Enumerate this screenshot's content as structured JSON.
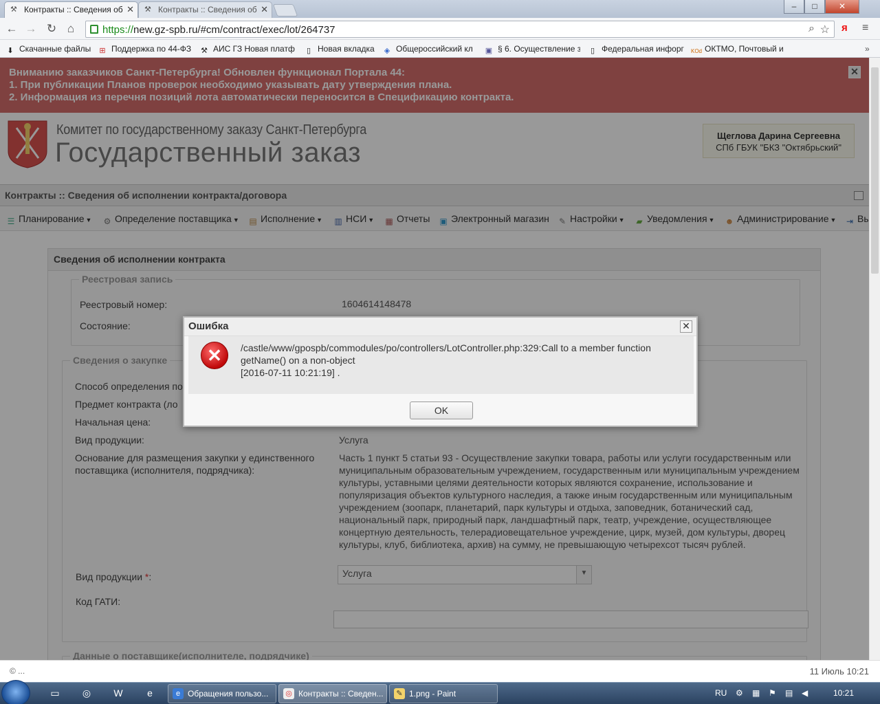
{
  "browser": {
    "tabs": [
      {
        "label": "Контракты :: Сведения об",
        "active": true
      },
      {
        "label": "Контракты :: Сведения об",
        "active": false
      }
    ],
    "url_scheme": "https://",
    "url_rest": "new.gz-spb.ru/#cm/contract/exec/lot/264737",
    "bookmarks": [
      {
        "label": "Скачанные файлы",
        "icon": "download-icon"
      },
      {
        "label": "Поддержка по 44-ФЗ",
        "icon": "support-icon"
      },
      {
        "label": "АИС ГЗ Новая платф",
        "icon": "tools-icon"
      },
      {
        "label": "Новая вкладка",
        "icon": "page-icon"
      },
      {
        "label": "Общероссийский кл",
        "icon": "ok-icon"
      },
      {
        "label": "§ 6. Осуществление з",
        "icon": "doc-icon"
      },
      {
        "label": "Федеральная инфорг",
        "icon": "page-icon"
      },
      {
        "label": "ОКТМО, Почтовый и",
        "icon": "kod-icon"
      }
    ],
    "window_controls": [
      "–",
      "□",
      "✕"
    ]
  },
  "banner": {
    "lines": [
      "Вниманию заказчиков Санкт-Петербурга! Обновлен функционал Портала 44:",
      "1. При публикации Планов проверок необходимо указывать дату утверждения плана.",
      "2. Информация из перечня позиций лота автоматически переносится в Спецификацию контракта."
    ],
    "close": "✕"
  },
  "header": {
    "brand_line1": "Комитет по государственному заказу Санкт-Петербурга",
    "brand_line2": "Государственный заказ",
    "user_name": "Щеглова Дарина Сергеевна",
    "user_org": "СПб ГБУК \"БКЗ \"Октябрьский\""
  },
  "breadcrumb": "Контракты :: Сведения об исполнении контракта/договора",
  "menu": [
    {
      "label": "Планирование",
      "icon": "planning-icon",
      "dropdown": true
    },
    {
      "label": "Определение поставщика",
      "icon": "gears-icon",
      "dropdown": true
    },
    {
      "label": "Исполнение",
      "icon": "execution-icon",
      "dropdown": true
    },
    {
      "label": "НСИ",
      "icon": "book-icon",
      "dropdown": true
    },
    {
      "label": "Отчеты",
      "icon": "report-icon",
      "dropdown": false
    },
    {
      "label": "Электронный магазин",
      "icon": "cart-icon",
      "dropdown": false
    },
    {
      "label": "Настройки",
      "icon": "wrench-icon",
      "dropdown": true
    },
    {
      "label": "Уведомления",
      "icon": "bell-icon",
      "dropdown": true
    },
    {
      "label": "Администрирование",
      "icon": "user-icon",
      "dropdown": true
    },
    {
      "label": "Вы",
      "icon": "exit-icon",
      "dropdown": false
    }
  ],
  "panel": {
    "title": "Сведения об исполнении контракта",
    "registry": {
      "legend": "Реестровая запись",
      "reg_number_label": "Реестровый номер:",
      "reg_number_value": "1604614148478",
      "state_label": "Состояние:"
    },
    "purchase": {
      "legend": "Сведения о закупке",
      "method_label": "Способ определения по",
      "subject_label": "Предмет контракта (ло",
      "price_label": "Начальная цена:",
      "product_type_label": "Вид продукции:",
      "product_type_value": "Услуга",
      "basis_label": "Основание для размещения закупки у единственного поставщика (исполнителя, подрядчика):",
      "basis_value": "Часть 1 пункт 5 статьи 93 - Осуществление закупки товара, работы или услуги государственным или муниципальным образовательным учреждением, государственным или муниципальным учреждением культуры, уставными целями деятельности которых являются сохранение, использование и популяризация объектов культурного наследия, а также иным государственным или муниципальным учреждением (зоопарк, планетарий, парк культуры и отдыха, заповедник, ботанический сад, национальный парк, природный парк, ландшафтный парк, театр, учреждение, осуществляющее концертную деятельность, телерадиовещательное учреждение, цирк, музей, дом культуры, дворец культуры, клуб, библиотека, архив) на сумму, не превышающую четырехсот тысяч рублей.",
      "product_type2_label": "Вид продукции",
      "required_mark": "*",
      "label_colon": ":",
      "product_type2_value": "Услуга",
      "gati_label": "Код ГАТИ:",
      "gati_value": ""
    },
    "supplier_legend": "Данные о поставщике(исполнителе, подрядчике)"
  },
  "footer": {
    "copyright": "© ...",
    "datetime": "11 Июль 10:21"
  },
  "dialog": {
    "title": "Ошибка",
    "close": "✕",
    "message_line1": "/castle/www/gpospb/commodules/po/controllers/LotController.php:329:Call to a member function",
    "message_line2": "getName() on a non-object",
    "message_line3": "[2016-07-11 10:21:19] .",
    "ok_label": "OK"
  },
  "taskbar": {
    "items": [
      {
        "label": "Обращения пользо...",
        "active": false
      },
      {
        "label": "Контракты :: Сведен...",
        "active": true
      },
      {
        "label": "1.png - Paint",
        "active": false
      }
    ],
    "lang": "RU",
    "time": "10:21"
  }
}
